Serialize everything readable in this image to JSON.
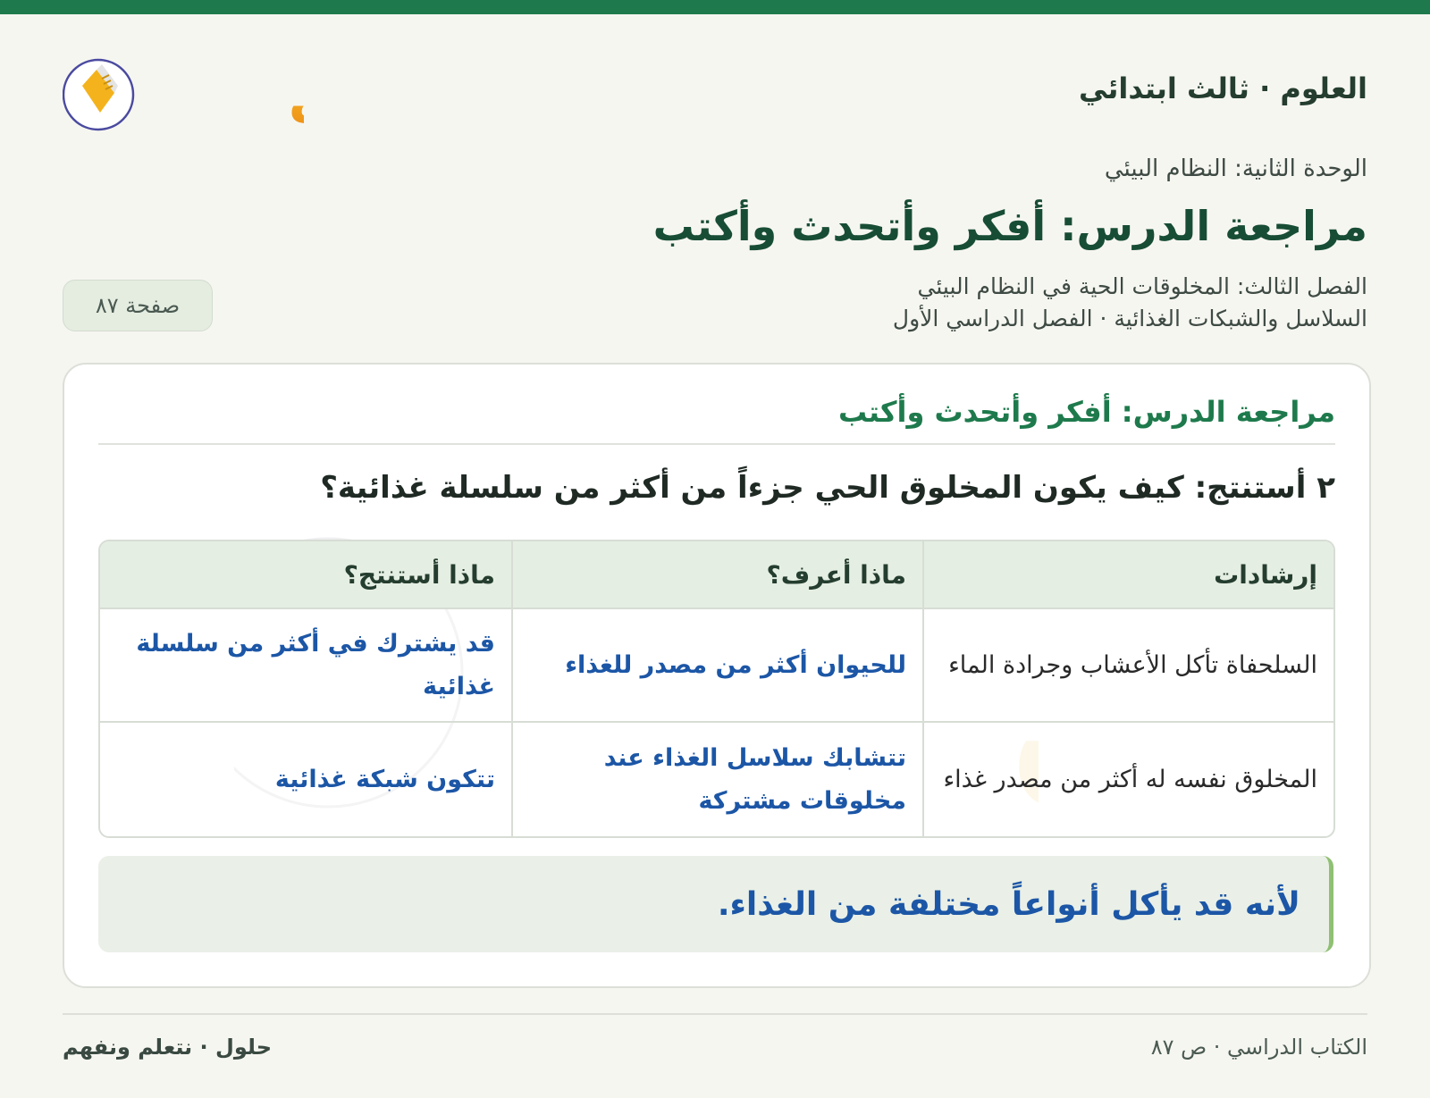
{
  "header": {
    "subject": "العلوم · ثالث ابتدائي",
    "logo_text": "حلول"
  },
  "lesson": {
    "unit": "الوحدة الثانية: النظام البيئي",
    "title": "مراجعة الدرس: أفكر وأتحدث وأكتب",
    "chapter": "الفصل الثالث: المخلوقات الحية في النظام البيئي",
    "topic": "السلاسل والشبكات الغذائية · الفصل الدراسي الأول",
    "page_badge": "صفحة ٨٧"
  },
  "card": {
    "title": "مراجعة الدرس: أفكر وأتحدث وأكتب",
    "question": "٢ أستنتج: كيف يكون المخلوق الحي جزءاً من أكثر من سلسلة غذائية؟",
    "table": {
      "headers": [
        "إرشادات",
        "ماذا أعرف؟",
        "ماذا أستنتج؟"
      ],
      "rows": [
        [
          "السلحفاة تأكل الأعشاب وجرادة الماء",
          "للحيوان أكثر من مصدر للغذاء",
          "قد يشترك في أكثر من سلسلة غذائية"
        ],
        [
          "المخلوق نفسه له أكثر من مصدر غذاء",
          "تتشابك سلاسل الغذاء عند مخلوقات مشتركة",
          "تتكون شبكة غذائية"
        ]
      ]
    },
    "answer": "لأنه قد يأكل أنواعاً مختلفة من الغذاء."
  },
  "footer": {
    "right": "الكتاب الدراسي · ص ٨٧",
    "left": "حلول · نتعلم ونفهم"
  },
  "colors": {
    "brand_green": "#1e7a4c",
    "answer_blue": "#1c56a6",
    "logo_orange": "#f0a020"
  }
}
